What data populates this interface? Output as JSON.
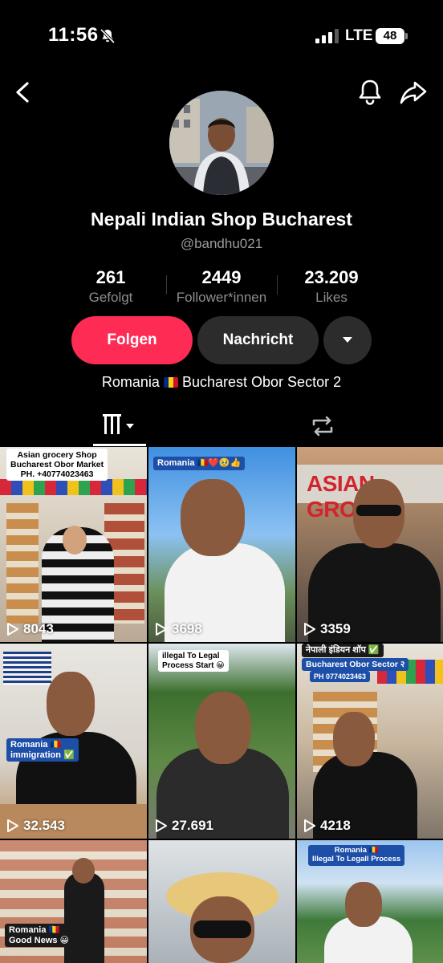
{
  "status": {
    "time": "11:56",
    "network": "LTE",
    "battery": "48"
  },
  "profile": {
    "display_name": "Nepali Indian Shop Bucharest",
    "handle": "@bandhu021",
    "bio_before_flag": "Romania",
    "bio_after_flag": "Bucharest Obor Sector 2"
  },
  "stats": [
    {
      "value": "261",
      "label": "Gefolgt"
    },
    {
      "value": "2449",
      "label": "Follower*innen"
    },
    {
      "value": "23.209",
      "label": "Likes"
    }
  ],
  "actions": {
    "follow_label": "Folgen",
    "message_label": "Nachricht"
  },
  "videos": [
    {
      "views": "8043",
      "caption": [
        "Asian grocery Shop",
        "Bucharest Obor Market",
        "PH. +40774023463"
      ]
    },
    {
      "views": "3698",
      "caption": [
        "Romania 🇷🇴❤️🥹👍"
      ]
    },
    {
      "views": "3359",
      "caption": [
        "ASIAN GROC"
      ]
    },
    {
      "views": "32.543",
      "caption": [
        "Romania 🇷🇴",
        "immigration ✅"
      ]
    },
    {
      "views": "27.691",
      "caption": [
        "illegal To Legal",
        "Process Start 😀"
      ]
    },
    {
      "views": "4218",
      "caption": [
        "नेपाली इंडियन शॉप ✅",
        "Bucharest Obor Sector २",
        "PH 0774023463"
      ]
    },
    {
      "views": "",
      "caption": [
        "Romania 🇷🇴",
        "Good News 😀"
      ]
    },
    {
      "views": "",
      "caption": []
    },
    {
      "views": "",
      "caption": [
        "Romania 🇷🇴",
        "Illegal To Legall Process"
      ]
    }
  ],
  "icons": {
    "back": "chevron-left-icon",
    "notifications": "bell-icon",
    "share": "share-icon",
    "silent": "bell-slash-icon",
    "videos_tab": "grid-columns-icon",
    "reposts_tab": "repost-icon",
    "more": "caret-down-icon",
    "play": "play-outline-icon"
  },
  "colors": {
    "follow": "#fe2c55",
    "secondary_button": "#2c2c2c",
    "muted_text": "#9b9b9b"
  }
}
